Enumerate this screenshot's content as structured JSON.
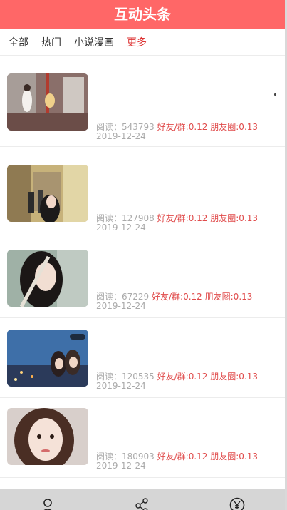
{
  "app": {
    "title": "互动头条"
  },
  "tabs": [
    {
      "label": "全部"
    },
    {
      "label": "热门"
    },
    {
      "label": "小说漫画"
    },
    {
      "label": "更多"
    }
  ],
  "feed": [
    {
      "reads_label": "阅读：543793",
      "share": "好友/群:0.12 朋友圈:0.13",
      "date": "2019-12-24"
    },
    {
      "reads_label": "阅读：127908",
      "share": "好友/群:0.12 朋友圈:0.13",
      "date": "2019-12-24"
    },
    {
      "reads_label": "阅读：67229",
      "share": "好友/群:0.12 朋友圈:0.13",
      "date": "2019-12-24"
    },
    {
      "reads_label": "阅读：120535",
      "share": "好友/群:0.12 朋友圈:0.13",
      "date": "2019-12-24"
    },
    {
      "reads_label": "阅读：180903",
      "share": "好友/群:0.12 朋友圈:0.13",
      "date": "2019-12-24"
    }
  ],
  "icons": {
    "tabbar": [
      "user-icon",
      "share-icon",
      "yuan-icon"
    ]
  },
  "colors": {
    "header_bg": "#ff6767",
    "accent_red": "#e04b4b",
    "meta_gray": "#aaaaaa"
  }
}
